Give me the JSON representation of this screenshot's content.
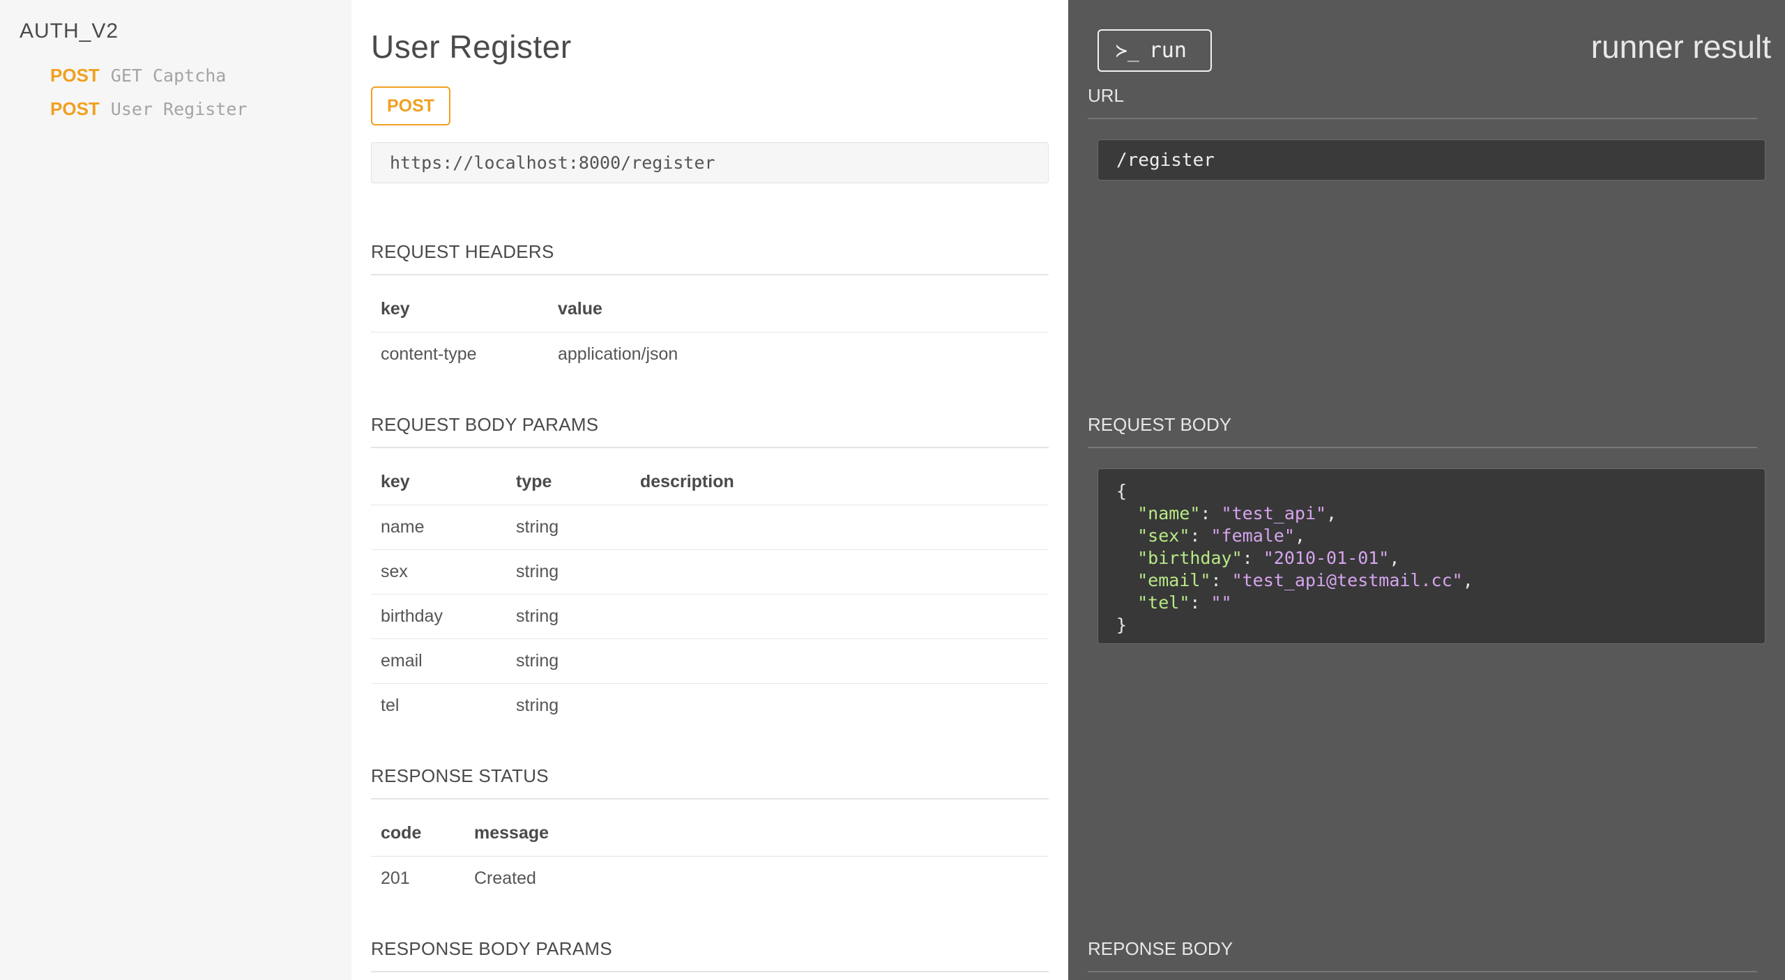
{
  "sidebar": {
    "title": "AUTH_V2",
    "items": [
      {
        "method": "POST",
        "label": "GET Captcha"
      },
      {
        "method": "POST",
        "label": "User Register"
      }
    ]
  },
  "main": {
    "title": "User Register",
    "method": "POST",
    "url": "https://localhost:8000/register",
    "request_headers": {
      "title": "REQUEST HEADERS",
      "columns": [
        "key",
        "value"
      ],
      "rows": [
        [
          "content-type",
          "application/json"
        ]
      ]
    },
    "request_body_params": {
      "title": "REQUEST BODY PARAMS",
      "columns": [
        "key",
        "type",
        "description"
      ],
      "rows": [
        [
          "name",
          "string",
          ""
        ],
        [
          "sex",
          "string",
          ""
        ],
        [
          "birthday",
          "string",
          ""
        ],
        [
          "email",
          "string",
          ""
        ],
        [
          "tel",
          "string",
          ""
        ]
      ]
    },
    "response_status": {
      "title": "RESPONSE STATUS",
      "columns": [
        "code",
        "message"
      ],
      "rows": [
        [
          "201",
          "Created"
        ]
      ]
    },
    "response_body_params": {
      "title": "RESPONSE BODY PARAMS"
    }
  },
  "runner": {
    "run_label": "run",
    "prompt_icon": "terminal-prompt-icon",
    "title": "runner result",
    "url_label": "URL",
    "url_value": "/register",
    "request_body_label": "REQUEST BODY",
    "request_body": {
      "open": "{",
      "close": "}",
      "fields": [
        {
          "key": "\"name\"",
          "value": "\"test_api\"",
          "sep": ","
        },
        {
          "key": "\"sex\"",
          "value": "\"female\"",
          "sep": ","
        },
        {
          "key": "\"birthday\"",
          "value": "\"2010-01-01\"",
          "sep": ","
        },
        {
          "key": "\"email\"",
          "value": "\"test_api@testmail.cc\"",
          "sep": ","
        },
        {
          "key": "\"tel\"",
          "value": "\"\"",
          "sep": ""
        }
      ]
    },
    "response_body_label": "REPONSE BODY"
  },
  "colors": {
    "accent": "#f0a020",
    "runner_bg": "#585858",
    "json_key": "#b8e986",
    "json_value": "#d6a5ee"
  }
}
